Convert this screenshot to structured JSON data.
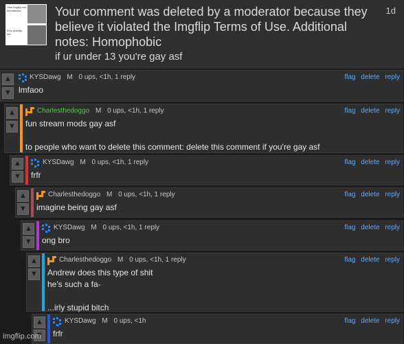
{
  "deleted_notice": {
    "message": "Your comment was deleted by a moderator because they believe it violated the Imgflip Terms of Use. Additional notes: Homophobic",
    "age": "1d",
    "text": "if ur under 13 you're gay asf",
    "thumbnail_caption_top": "How Imgflip see themselves",
    "thumbnail_caption_bottom": "they actually are"
  },
  "actions": {
    "flag": "flag",
    "delete": "delete",
    "reply": "reply"
  },
  "vote_icons": {
    "up": "arrow-up-icon",
    "down": "arrow-down-icon"
  },
  "colors": {
    "kysdawg": "#1f8bff",
    "charles": "#f7941d",
    "link": "#5aa9ff",
    "bars": [
      "#f7941d",
      "#d9342b",
      "#a0505a",
      "#b03bd0",
      "#1aa9dd",
      "#2a54d9"
    ]
  },
  "comments": [
    {
      "user": "KYSDawg",
      "user_color": "#5aa9ff",
      "mod": "M",
      "stats": "0 ups, <1h, 1 reply",
      "text": "lmfaoo"
    },
    {
      "user": "Charlesthedoggo",
      "user_color": "#4ecb3f",
      "mod": "M",
      "stats": "0 ups, <1h, 1 reply",
      "text": "fun stream mods gay asf\n\nto people who want to delete this comment: delete this comment if you're gay asf"
    },
    {
      "user": "KYSDawg",
      "user_color": "#c8c8c8",
      "mod": "M",
      "stats": "0 ups, <1h, 1 reply",
      "text": "frfr"
    },
    {
      "user": "Charlesthedoggo",
      "user_color": "#c8c8c8",
      "mod": "M",
      "stats": "0 ups, <1h, 1 reply",
      "text": "imagine being gay asf"
    },
    {
      "user": "KYSDawg",
      "user_color": "#c8c8c8",
      "mod": "M",
      "stats": "0 ups, <1h, 1 reply",
      "text": "ong bro"
    },
    {
      "user": "Charlesthedoggo",
      "user_color": "#c8c8c8",
      "mod": "M",
      "stats": "0 ups, <1h, 1 reply",
      "text": "Andrew does this type of shit\nhe's such a fa-\n\n...irly stupid bitch"
    },
    {
      "user": "KYSDawg",
      "user_color": "#c8c8c8",
      "mod": "M",
      "stats": "0 ups, <1h",
      "text": "frfr"
    }
  ],
  "watermark": "imgflip.com"
}
